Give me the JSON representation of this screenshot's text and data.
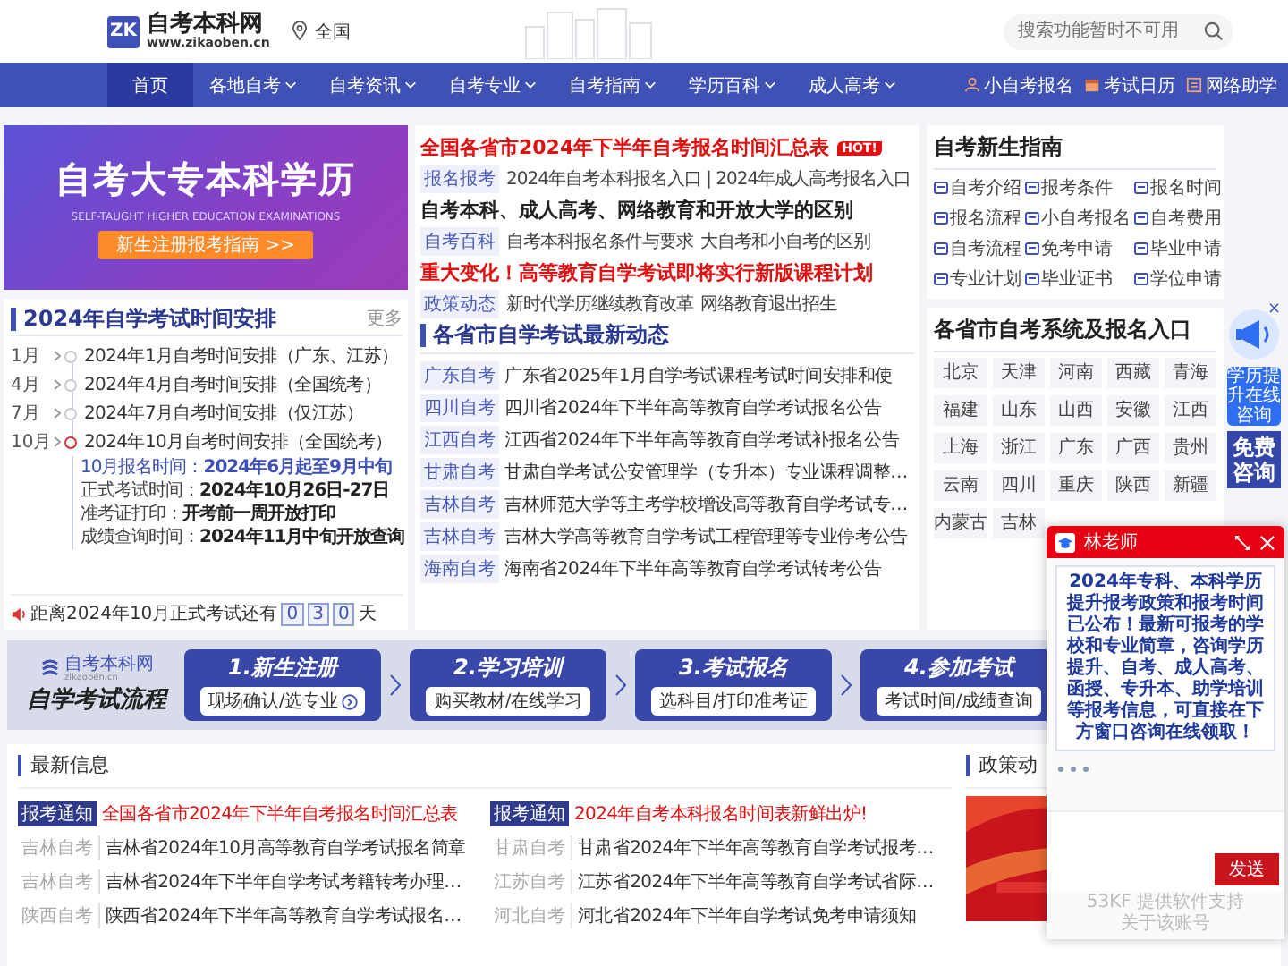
{
  "header": {
    "logo_mark": "ZK",
    "site_name": "自考本科网",
    "site_url": "www.zikaoben.cn",
    "location": "全国",
    "search": {
      "placeholder": "搜索功能暂时不可用"
    }
  },
  "nav": {
    "items": [
      {
        "label": "首页",
        "selected": true,
        "dropdown": false
      },
      {
        "label": "各地自考",
        "selected": false,
        "dropdown": true
      },
      {
        "label": "自考资讯",
        "selected": false,
        "dropdown": true
      },
      {
        "label": "自考专业",
        "selected": false,
        "dropdown": true
      },
      {
        "label": "自考指南",
        "selected": false,
        "dropdown": true
      },
      {
        "label": "学历百科",
        "selected": false,
        "dropdown": true
      },
      {
        "label": "成人高考",
        "selected": false,
        "dropdown": true
      }
    ],
    "links": [
      "小自考报名",
      "考试日历",
      "网络助学"
    ]
  },
  "banner": {
    "title": "自考大专本科学历",
    "subtitle": "SELF-TAUGHT HIGHER EDUCATION EXAMINATIONS",
    "button": "新生注册报考指南 >>"
  },
  "schedule": {
    "title": "2024年自学考试时间安排",
    "more": "更多",
    "items": [
      {
        "month": "1月",
        "text": "2024年1月自考时间安排（广东、江苏）",
        "expanded": false
      },
      {
        "month": "4月",
        "text": "2024年4月自考时间安排（全国统考）",
        "expanded": false
      },
      {
        "month": "7月",
        "text": "2024年7月自考时间安排（仅江苏）",
        "expanded": false
      },
      {
        "month": "10月",
        "text": "2024年10月自考时间安排（全国统考）",
        "expanded": true,
        "details": [
          {
            "label": "10月报名时间：",
            "value": "2024年6月起至9月中旬",
            "highlight": true
          },
          {
            "label": "正式考试时间：",
            "value": "2024年10月26日-27日",
            "highlight": false
          },
          {
            "label": "准考证打印：",
            "value": "开考前一周开放打印",
            "highlight": false
          },
          {
            "label": "成绩查询时间：",
            "value": "2024年11月中旬开放查询",
            "highlight": false
          }
        ]
      }
    ],
    "countdown": {
      "prefix": "距离2024年10月正式考试还有",
      "digits": [
        "0",
        "3",
        "0"
      ],
      "suffix": "天"
    }
  },
  "headlines": [
    {
      "title": "全国各省市2024年下半年自考报名时间汇总表",
      "kind": "red",
      "badge": "HOT!",
      "tag": "报名报考",
      "links": [
        "2024年自考本科报名入口 | 2024年成人高考报名入口"
      ]
    },
    {
      "title": "自考本科、成人高考、网络教育和开放大学的区别",
      "kind": "dark",
      "tag": "自考百科",
      "links": [
        "自考本科报名条件与要求",
        "大自考和小自考的区别"
      ]
    },
    {
      "title": "重大变化！高等教育自学考试即将实行新版课程计划",
      "kind": "red",
      "tag": "政策动态",
      "links": [
        "新时代学历继续教育改革",
        "网络教育退出招生"
      ]
    }
  ],
  "news": {
    "title": "各省市自学考试最新动态",
    "rows": [
      {
        "tag": "广东自考",
        "text": "广东省2025年1月自学考试课程考试时间安排和使"
      },
      {
        "tag": "四川自考",
        "text": "四川省2024年下半年高等教育自学考试报名公告"
      },
      {
        "tag": "江西自考",
        "text": "江西省2024年下半年高等教育自学考试补报名公告"
      },
      {
        "tag": "甘肃自考",
        "text": "甘肃自学考试公安管理学（专升本）专业课程调整…"
      },
      {
        "tag": "吉林自考",
        "text": "吉林师范大学等主考学校增设高等教育自学考试专…"
      },
      {
        "tag": "吉林自考",
        "text": "吉林大学高等教育自学考试工程管理等专业停考公告"
      },
      {
        "tag": "海南自考",
        "text": "海南省2024年下半年高等教育自学考试转考公告"
      }
    ]
  },
  "guide": {
    "title": "自考新生指南",
    "items": [
      "自考介绍",
      "报考条件",
      "报名时间",
      "报名流程",
      "小自考报名",
      "自考费用",
      "自考流程",
      "免考申请",
      "毕业申请",
      "专业计划",
      "毕业证书",
      "学位申请"
    ]
  },
  "provinces": {
    "title": "各省市自考系统及报名入口",
    "items": [
      "北京",
      "天津",
      "河南",
      "西藏",
      "青海",
      "福建",
      "山东",
      "山西",
      "安徽",
      "江西",
      "上海",
      "浙江",
      "广东",
      "广西",
      "贵州",
      "云南",
      "四川",
      "重庆",
      "陕西",
      "新疆",
      "内蒙古",
      "吉林"
    ]
  },
  "float_consult": {
    "close": "×",
    "badge": "学历提升在线咨询",
    "button": "免费咨询"
  },
  "flow": {
    "logo": "自考本科网",
    "url": "zikaoben.cn",
    "title": "自学考试流程",
    "steps": [
      {
        "title": "1.新生注册",
        "sub": "现场确认/选专业"
      },
      {
        "title": "2.学习培训",
        "sub": "购买教材/在线学习"
      },
      {
        "title": "3.考试报名",
        "sub": "选科目/打印准考证"
      },
      {
        "title": "4.参加考试",
        "sub": "考试时间/成绩查询"
      }
    ]
  },
  "latest": {
    "title": "最新信息",
    "columns": [
      [
        {
          "tag": "报考通知",
          "text": "全国各省市2024年下半年自考报名时间汇总表",
          "kind": "notice"
        },
        {
          "tag": "吉林自考",
          "text": "吉林省2024年10月高等教育自学考试报名简章",
          "kind": "region"
        },
        {
          "tag": "吉林自考",
          "text": "吉林省2024年下半年自学考试考籍转考办理…",
          "kind": "region"
        },
        {
          "tag": "陕西自考",
          "text": "陕西省2024年下半年高等教育自学考试报名…",
          "kind": "region"
        }
      ],
      [
        {
          "tag": "报考通知",
          "text": "2024年自考本科报名时间表新鲜出炉!",
          "kind": "notice"
        },
        {
          "tag": "甘肃自考",
          "text": "甘肃省2024年下半年高等教育自学考试报考…",
          "kind": "region"
        },
        {
          "tag": "江苏自考",
          "text": "江苏省2024年下半年高等教育自学考试省际…",
          "kind": "region"
        },
        {
          "tag": "河北自考",
          "text": "河北省2024年下半年自学考试免考申请须知",
          "kind": "region"
        }
      ]
    ]
  },
  "policy": {
    "title": "政策动"
  },
  "chat": {
    "agent": "林老师",
    "message": "2024年专科、本科学历提升报考政策和报考时间已公布！最新可报考的学校和专业简章，咨询学历提升、自考、成人高考、函授、专升本、助学培训等报考信息，可直接在下方窗口咨询在线领取！",
    "send": "发送",
    "footer": [
      "53KF 提供软件支持",
      "关于该账号"
    ]
  }
}
